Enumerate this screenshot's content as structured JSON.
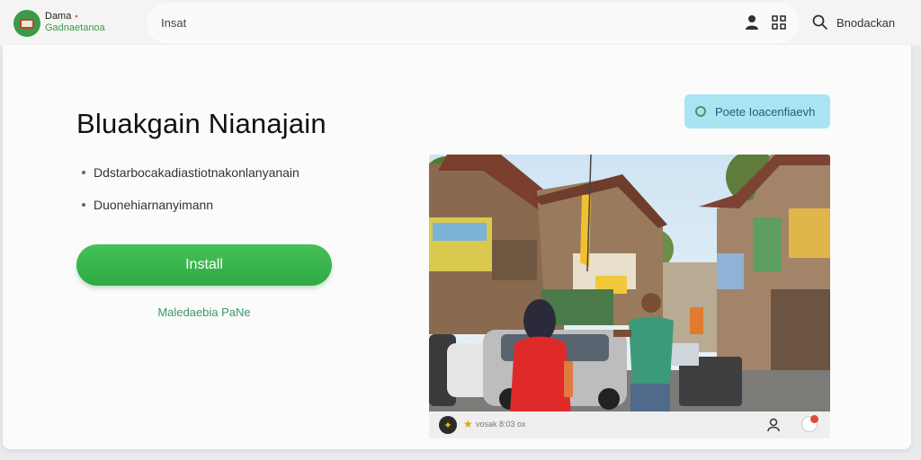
{
  "header": {
    "brand_name": "Dama",
    "brand_dot": "▪",
    "brand_subtitle": "Gadnaetanoa",
    "search_placeholder": "Insat",
    "right_link": "Bnodackan",
    "icons": [
      "logo-icon",
      "user-icon",
      "grid-icon",
      "search-icon"
    ]
  },
  "main": {
    "title": "Bluakgain Nianajain",
    "bullets": [
      "Ddstarbocakadiastiotnakonlanyanain",
      "Duonehiarnanyimann"
    ],
    "install_label": "Install",
    "secondary_link": "Maledaebia PaNe",
    "info_pill": "Poete Ioacenfiaevh",
    "photo_footer": {
      "meta_text": "vosak  8:03  ox",
      "icons": [
        "compass-icon",
        "star-icon",
        "person-icon",
        "notification-badge"
      ]
    }
  },
  "colors": {
    "accent_green": "#2fa944",
    "info_pill_bg": "#a9e4f2",
    "link_green": "#3a9a6a"
  }
}
